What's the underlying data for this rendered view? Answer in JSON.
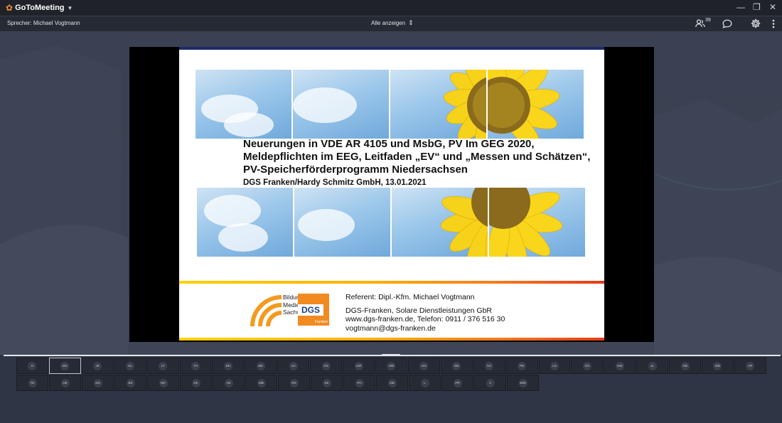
{
  "app": {
    "name": "GoToMeeting"
  },
  "toolbar": {
    "speaker": "Sprecher: Michael Vogtmann",
    "view_label": "Alle anzeigen",
    "attendee_count": "39"
  },
  "slide": {
    "title": "Neuerungen in VDE AR 4105 und MsbG, PV Im GEG 2020, Meldepflichten im EEG, Leitfaden „EV“ und „Messen und Schätzen“, PV-Speicherförderprogramm Niedersachsen",
    "subtitle": "DGS Franken/Hardy Schmitz GmbH, 13.01.2021",
    "logo_lines": [
      "Bildung",
      "Medien",
      "Sachverstand"
    ],
    "dgs_logo": "DGS",
    "dgs_sub": "Franken",
    "referent": "Referent: Dipl.-Kfm. Michael Vogtmann",
    "company": "DGS-Franken, Solare Dienstleistungen GbR",
    "contact": "www.dgs-franken.de, Telefon: 0911 / 376 516 30",
    "email": "vogtmann@dgs-franken.de"
  },
  "attendees": {
    "row1": [
      "H",
      "MV",
      "JK",
      "KL",
      "LT",
      "TH",
      "DH",
      "MK",
      "HJ",
      "OS",
      "UW",
      "HW",
      "HH",
      "EB",
      "KK",
      "PD",
      "LS",
      "GS",
      "HW",
      "JL",
      "GB",
      "MD",
      "HF"
    ],
    "row2": [
      "TE",
      "HE",
      "DS",
      "EE",
      "MV",
      "KE",
      "AE",
      "MB",
      "RS",
      "KE",
      "PH",
      "DB",
      "L",
      "PR",
      "A",
      "WW"
    ]
  },
  "colors": {
    "accent": "#f68d2e",
    "titlebar": "#1f2229",
    "stage": "#3a4152"
  }
}
